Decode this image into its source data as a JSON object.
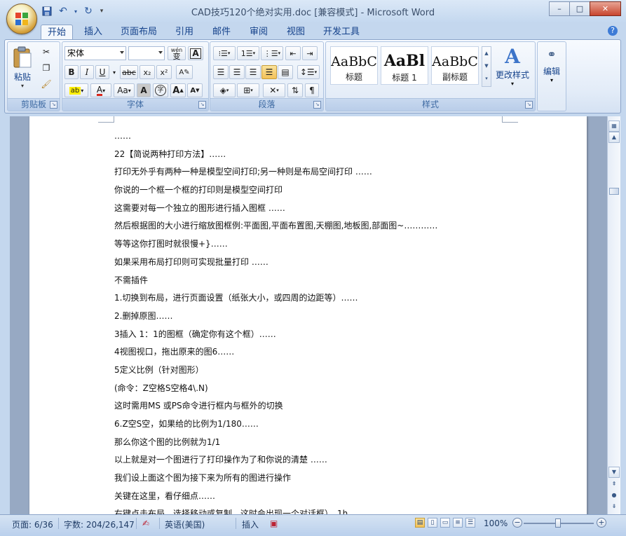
{
  "window": {
    "title": "CAD技巧120个绝对实用.doc [兼容模式] - Microsoft Word",
    "minimize": "–",
    "maximize": "□",
    "close": "✕"
  },
  "tabs": [
    {
      "label": "开始"
    },
    {
      "label": "插入"
    },
    {
      "label": "页面布局"
    },
    {
      "label": "引用"
    },
    {
      "label": "邮件"
    },
    {
      "label": "审阅"
    },
    {
      "label": "视图"
    },
    {
      "label": "开发工具"
    }
  ],
  "ribbon": {
    "clipboard": {
      "label": "剪贴板",
      "paste": "粘贴"
    },
    "font": {
      "label": "字体",
      "font_name": "宋体",
      "font_size": "",
      "wen": "wén",
      "wen_char": "变",
      "bold": "B",
      "italic": "I",
      "underline": "U",
      "strike": "abc",
      "sub": "x₂",
      "sup": "x²",
      "aa": "Aa",
      "grow": "A",
      "shrink": "A",
      "circle_char": "字"
    },
    "paragraph": {
      "label": "段落"
    },
    "styles": {
      "label": "样式",
      "tiles": [
        {
          "preview": "AaBbC",
          "name": "标题"
        },
        {
          "preview": "AaBl",
          "name": "标题 1"
        },
        {
          "preview": "AaBbC",
          "name": "副标题"
        }
      ],
      "change_styles": "更改样式"
    },
    "editing": {
      "label": "编辑"
    }
  },
  "document": {
    "lines": [
      "……",
      "22【简说两种打印方法】……",
      "打印无外乎有两种一种是模型空间打印;另一种则是布局空间打印 ……",
      "你说的一个框一个框的打印则是模型空间打印",
      "这需要对每一个独立的图形进行插入图框 ……",
      "然后根据图的大小进行缩放图框例:平面图,平面布置图,天棚图,地板图,部面图~…………",
      "等等这你打图时就很慢+}……",
      "如果采用布局打印则可实现批量打印 ……",
      "不需插件",
      "1.切换到布局，进行页面设置（纸张大小，或四周的边距等）……",
      "2.删掉原图……",
      "3插入 1：1的图框（确定你有这个框）……",
      "4视图视口，拖出原来的图6……",
      "5定义比例（针对图形）",
      "(命令：Z空格S空格4\\.N)",
      "这时需用MS 或PS命令进行框内与框外的切换",
      "6.Z空S空，如果给的比例为1/180……",
      "那么你这个图的比例就为1/1",
      "以上就是对一个图进行了打印操作为了和你说的清楚 ……",
      "我们设上面这个图为接下来为所有的图进行操作",
      "关键在这里，看仔细点……",
      "右键点击布局，选择移动或复制，这时会出现一个对话框），1h"
    ]
  },
  "status": {
    "page": "页面: 6/36",
    "words": "字数: 204/26,147",
    "language": "英语(美国)",
    "insert": "插入",
    "zoom": "100%",
    "zoom_level_percent": 100
  }
}
